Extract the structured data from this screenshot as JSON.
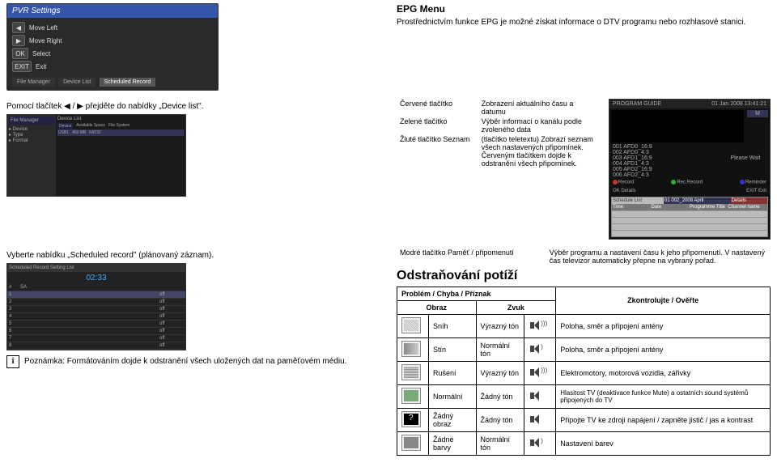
{
  "pvr_screenshot": {
    "title": "PVR Settings",
    "rows": [
      {
        "key": "◀",
        "label": "Move Left"
      },
      {
        "key": "▶",
        "label": "Move Right"
      }
    ],
    "ok": {
      "key": "OK",
      "label": "Select"
    },
    "exit": {
      "key": "EXIT",
      "label": "Exit"
    },
    "tabs": [
      "File Manager",
      "Device List",
      "Scheduled Record"
    ]
  },
  "epg": {
    "heading": "EPG Menu",
    "description": "Prostřednictvím funkce EPG je možné získat informace o DTV programu nebo rozhlasové stanici.",
    "left_hint": "Pomocí tlačítek ◀ / ▶ přejděte do nabídky „Device list\".",
    "colors": {
      "red_label": "Červené tlačítko",
      "red_desc": "Zobrazení aktuálního času a datumu",
      "green_label": "Zelené tlačítko",
      "green_desc": "Výběr informací o kanálu podle zvoleného data",
      "yellow_label": "Žluté tlačítko Seznam",
      "yellow_desc": "(tlačítko teletextu) Zobrazí seznam všech nastavených připomínek. Červeným tlačítkem dojde k odstranění všech připomínek.",
      "blue_label": "Modré tlačítko Paměť / připomenutí",
      "blue_desc": "Výběr programu a nastavení času k jeho připomenutí. V nastavený čas televizor automaticky přepne na vybraný pořad."
    },
    "sched_record_hint": "Vyberte nabídku „Scheduled record\" (plánovaný záznam).",
    "info_note": "Poznámka: Formátováním dojde k odstranění všech uložených dat na paměťovém médiu."
  },
  "prog_guide": {
    "title": "PROGRAM GUIDE",
    "datetime": "01 Jan 2008 13:41:21",
    "please_wait": "Please Wait",
    "channels": [
      "001  AFD0_16:9",
      "002  AFD0_4:3",
      "003  AFD1_16:9",
      "004  AFD1_4:3",
      "005  AFD2_16:9",
      "006  AFD2_4:3"
    ],
    "movie_label": "M",
    "legend": {
      "record": "Record",
      "rec_record": "Rec.Record",
      "reminder": "Reminder",
      "ok": "OK Details",
      "exit": "EXIT Exit"
    },
    "sched": {
      "tabs": [
        "Schedule List",
        "01 002_2008 April",
        "Details"
      ],
      "cols": [
        "Time",
        "Date",
        "Programme Title",
        "Channel name"
      ]
    }
  },
  "troubleshoot": {
    "heading": "Odstraňování potíží",
    "thead": {
      "problem": "Problém / Chyba / Příznak",
      "image": "Obraz",
      "sound": "Zvuk",
      "check": "Zkontrolujte / Ověřte"
    },
    "rows": [
      {
        "image": "Sníh",
        "sound": "Výrazný tón",
        "check": "Poloha, směr a připojení antény",
        "tv": "tv-snow",
        "spk": "wave"
      },
      {
        "image": "Stín",
        "sound": "Normální tón",
        "check": "Poloha, směr a připojení antény",
        "tv": "tv-shadow",
        "spk": "wave-low"
      },
      {
        "image": "Rušení",
        "sound": "Výrazný tón",
        "check": "Elektromotory, motorová vozidla, zářivky",
        "tv": "tv-noise",
        "spk": "wave"
      },
      {
        "image": "Normální",
        "sound": "Žádný tón",
        "check": "Hlasitost TV (deaktivace funkce Mute) a ostatních sound systémů připojených do TV",
        "tv": "tv-normal",
        "spk": ""
      },
      {
        "image": "Žádný obraz",
        "sound": "Žádný tón",
        "check": "Připojte TV ke zdroji napájení / zapněte jistič / jas a kontrast",
        "tv": "tv-black",
        "spk": ""
      },
      {
        "image": "Žádné barvy",
        "sound": "Normální tón",
        "check": "Nastavení barev",
        "tv": "tv-nocolor",
        "spk": "wave-low"
      }
    ]
  },
  "misc": {
    "info_icon": "i",
    "question": "?"
  }
}
